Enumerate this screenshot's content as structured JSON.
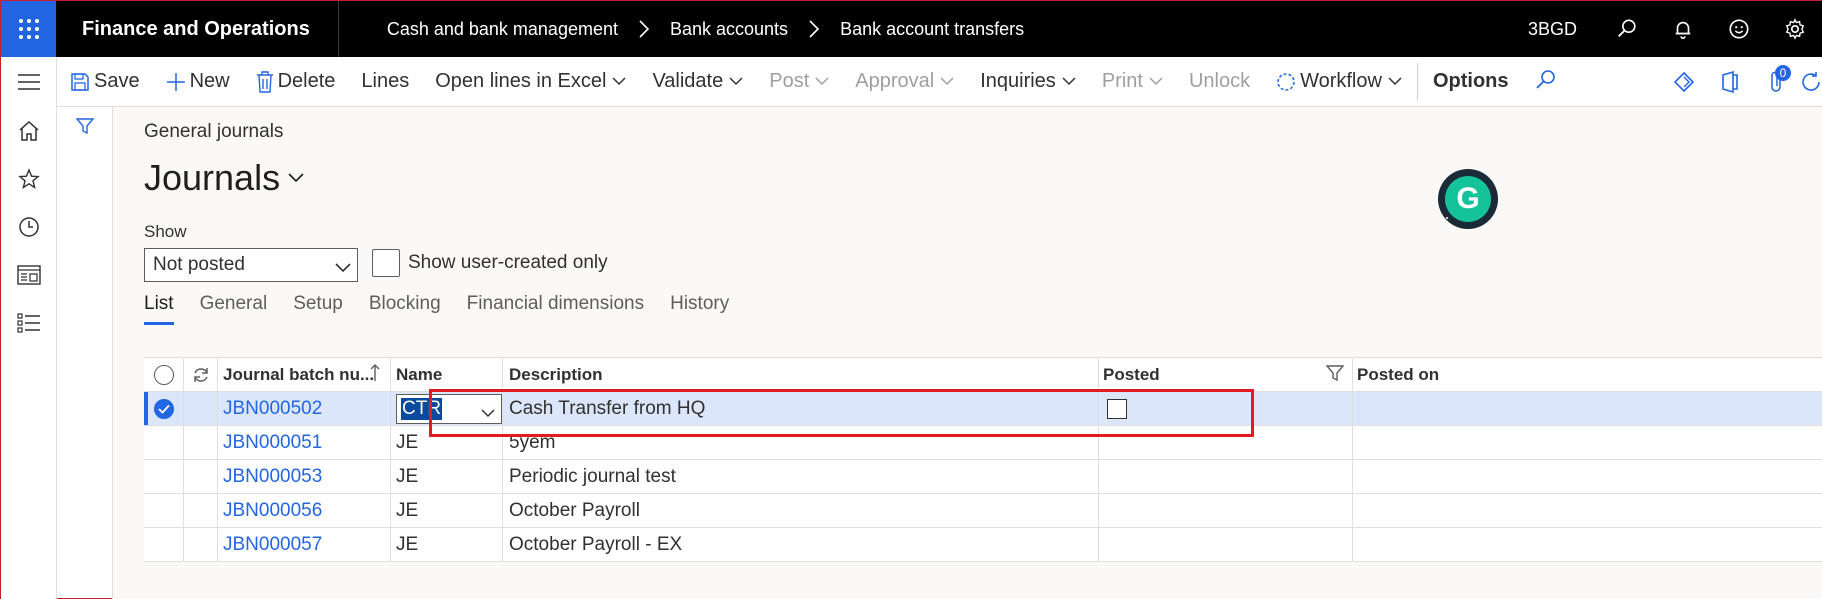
{
  "topbar": {
    "app_name": "Finance and Operations",
    "breadcrumbs": [
      "Cash and bank management",
      "Bank accounts",
      "Bank account transfers"
    ],
    "company": "3BGD"
  },
  "actions": {
    "save": "Save",
    "new": "New",
    "delete": "Delete",
    "lines": "Lines",
    "open_in_excel": "Open lines in Excel",
    "validate": "Validate",
    "post": "Post",
    "approval": "Approval",
    "inquiries": "Inquiries",
    "print": "Print",
    "unlock": "Unlock",
    "workflow": "Workflow",
    "options": "Options",
    "notification_count": "0"
  },
  "page": {
    "form_caption": "General journals",
    "title": "Journals",
    "show_label": "Show",
    "show_value": "Not posted",
    "user_created_label": "Show user-created only"
  },
  "tabs": [
    "List",
    "General",
    "Setup",
    "Blocking",
    "Financial dimensions",
    "History"
  ],
  "grid": {
    "columns": {
      "batch": "Journal batch nu...",
      "name": "Name",
      "description": "Description",
      "posted": "Posted",
      "posted_on": "Posted on"
    },
    "rows": [
      {
        "batch": "JBN000502",
        "name": "CTR",
        "description": "Cash Transfer from HQ"
      },
      {
        "batch": "JBN000051",
        "name": "JE",
        "description": "5yem"
      },
      {
        "batch": "JBN000053",
        "name": "JE",
        "description": "Periodic journal test"
      },
      {
        "batch": "JBN000056",
        "name": "JE",
        "description": "October Payroll"
      },
      {
        "batch": "JBN000057",
        "name": "JE",
        "description": "October Payroll - EX"
      }
    ]
  },
  "grammarly": {
    "letter": "G"
  },
  "colors": {
    "accent": "#2266e3",
    "highlight": "#e01b24",
    "selected_row": "#dbe6fb"
  }
}
